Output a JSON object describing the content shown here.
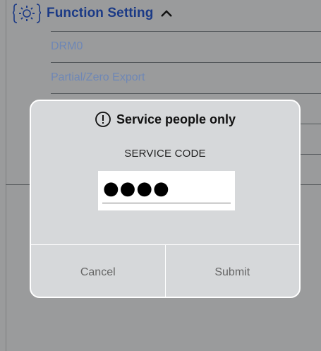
{
  "background": {
    "header": {
      "title": "Function Setting",
      "icon": "gear-icon",
      "toggle_icon": "chevron-up-icon"
    },
    "items": [
      {
        "label": "DRM0"
      },
      {
        "label": "Partial/Zero Export"
      }
    ]
  },
  "dialog": {
    "title": "Service people only",
    "title_icon": "exclamation-circle-icon",
    "field_label": "SERVICE CODE",
    "code_masked": "●●●●",
    "cancel_label": "Cancel",
    "submit_label": "Submit"
  },
  "colors": {
    "accent": "#1b3a86",
    "link": "#6e87b6",
    "overlay": "#9a9b9c",
    "dialog_bg": "#d6d8da"
  }
}
